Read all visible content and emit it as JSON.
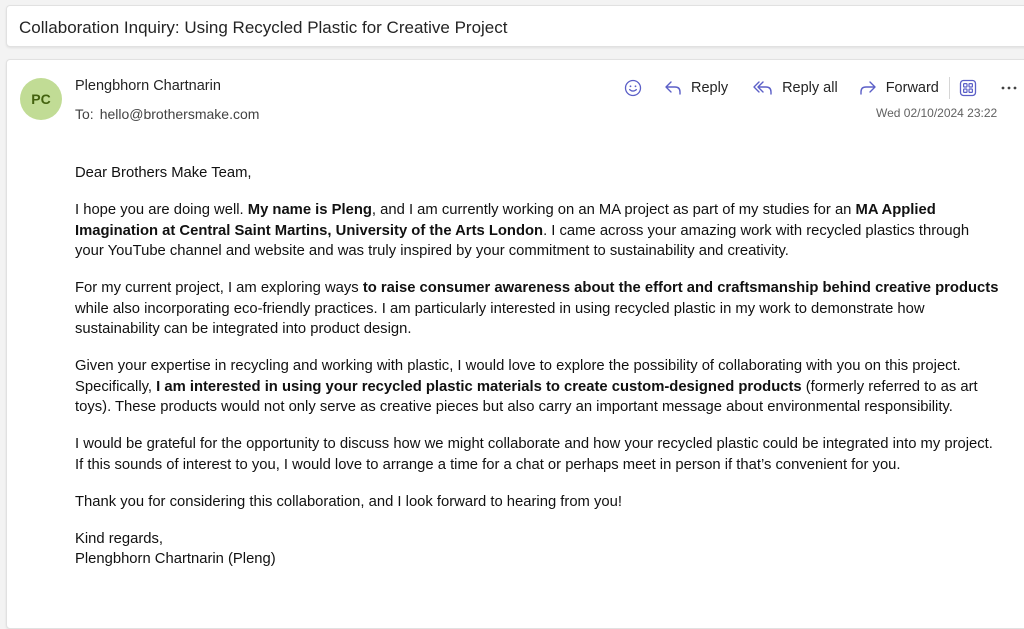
{
  "subject": "Collaboration Inquiry: Using Recycled Plastic for Creative Project",
  "sender": {
    "initials": "PC",
    "name": "Plengbhorn Chartnarin",
    "to_label": "To:",
    "to_address": "hello@brothersmake.com",
    "date": "Wed 02/10/2024 23:22",
    "avatar_color": "#c1dc95"
  },
  "toolbar": {
    "reply": "Reply",
    "reply_all": "Reply all",
    "forward": "Forward",
    "accent_color": "#5b5fc7",
    "icons": [
      "emoji-icon",
      "reply-icon",
      "reply-all-icon",
      "forward-icon",
      "apps-icon",
      "more-icon"
    ]
  },
  "body": {
    "greeting": "Dear Brothers Make Team,",
    "p1": [
      "I hope you are doing well. ",
      "My name is Pleng",
      ", and I am currently working on an MA project as part of my studies for an ",
      "MA Applied Imagination at Central Saint Martins, University of the Arts London",
      ". I came across your amazing work with recycled plastics through your YouTube channel and website and was truly inspired by your commitment to sustainability and creativity."
    ],
    "p2": [
      "For my current project, I am exploring ways ",
      "to raise consumer awareness about the effort and craftsmanship behind creative products",
      " while also incorporating eco-friendly practices. I am particularly interested in using recycled plastic in my work to demonstrate how sustainability can be integrated into product design."
    ],
    "p3": [
      "Given your expertise in recycling and working with plastic, I would love to explore the possibility of collaborating with you on this project. Specifically, ",
      "I am interested in using your recycled plastic materials to create custom-designed products",
      " (formerly referred to as art toys). These products would not only serve as creative pieces but also carry an important message about environmental responsibility."
    ],
    "p4": "I would be grateful for the opportunity to discuss how we might collaborate and how your recycled plastic could be integrated into my project. If this sounds of interest to you, I would love to arrange a time for a chat or perhaps meet in person if that’s convenient for you.",
    "p5": "Thank you for considering this collaboration, and I look forward to hearing from you!",
    "closing": "Kind regards,",
    "signature": "Plengbhorn Chartnarin (Pleng)"
  }
}
